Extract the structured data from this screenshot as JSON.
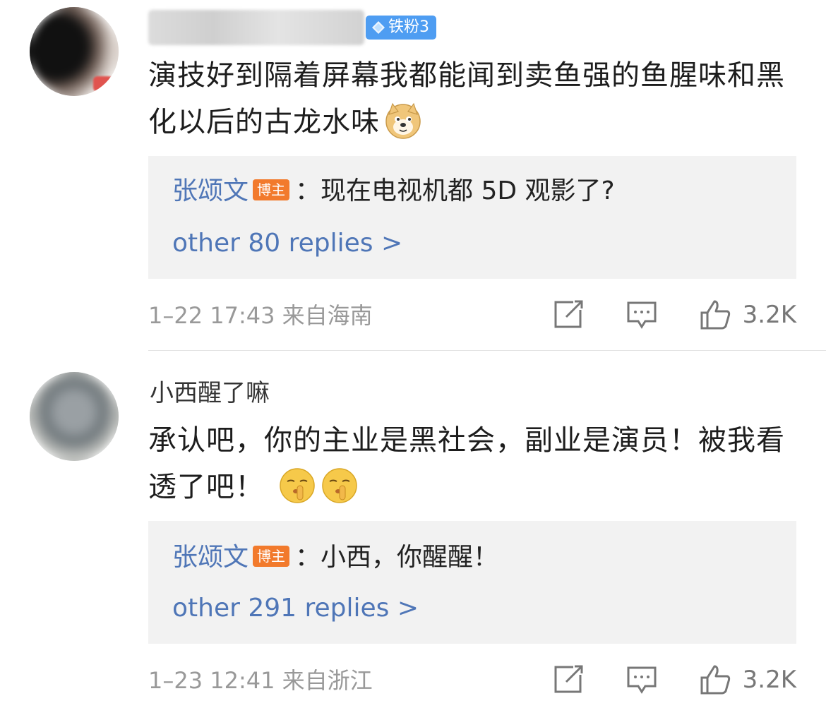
{
  "comments": [
    {
      "fan_badge": "铁粉3",
      "text": "演技好到隔着屏幕我都能闻到卖鱼强的鱼腥味和黑化以后的古龙水味",
      "emoji": "doge-icon",
      "reply": {
        "author": "张颂文",
        "author_badge": "博主",
        "text": "：现在电视机都 5D 观影了?"
      },
      "more_replies": "other 80 replies >",
      "timestamp": "1–22 17:43",
      "location": "来自海南",
      "likes": "3.2K"
    },
    {
      "username": "小西醒了嘛",
      "text": "承认吧，你的主业是黑社会，副业是演员！被我看透了吧！",
      "emoji": "shush-icon",
      "reply": {
        "author": "张颂文",
        "author_badge": "博主",
        "text": "：小西，你醒醒！"
      },
      "more_replies": "other 291 replies >",
      "timestamp": "1–23 12:41",
      "location": "来自浙江",
      "likes": "3.2K"
    }
  ],
  "colors": {
    "link": "#4f76b7",
    "fan_badge": "#4e9df2",
    "blogger_badge": "#f27a2c",
    "meta": "#999999",
    "reply_bg": "#f2f2f2"
  }
}
